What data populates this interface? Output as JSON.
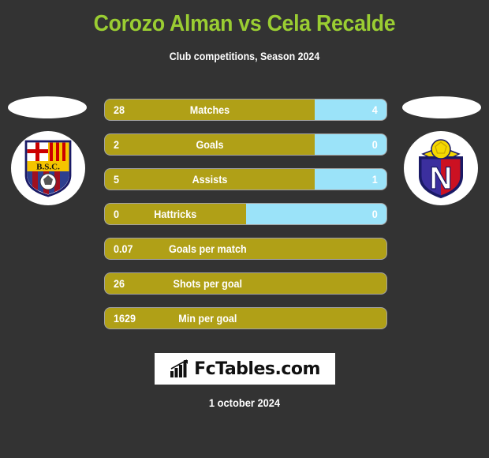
{
  "header": {
    "title": "Corozo Alman vs Cela Recalde",
    "subtitle": "Club competitions, Season 2024",
    "title_color": "#9ACD32",
    "background_color": "#333333"
  },
  "teams": {
    "home": {
      "crest_name": "barcelona-sc-crest",
      "crest_text": "B.S.C."
    },
    "away": {
      "crest_name": "el-nacional-crest",
      "crest_text": "N"
    }
  },
  "colors": {
    "home_bar": "#B0A017",
    "away_bar": "#9BE3F9",
    "text": "#ffffff"
  },
  "stats": [
    {
      "label": "Matches",
      "home": "28",
      "away": "4",
      "home_pct": 74.5,
      "two_sided": true
    },
    {
      "label": "Goals",
      "home": "2",
      "away": "0",
      "home_pct": 74.5,
      "two_sided": true
    },
    {
      "label": "Assists",
      "home": "5",
      "away": "1",
      "home_pct": 74.5,
      "two_sided": true
    },
    {
      "label": "Hattricks",
      "home": "0",
      "away": "0",
      "home_pct": 50.0,
      "two_sided": true
    },
    {
      "label": "Goals per match",
      "home": "0.07",
      "away": "",
      "home_pct": 100,
      "two_sided": false
    },
    {
      "label": "Shots per goal",
      "home": "26",
      "away": "",
      "home_pct": 100,
      "two_sided": false
    },
    {
      "label": "Min per goal",
      "home": "1629",
      "away": "",
      "home_pct": 100,
      "two_sided": false
    }
  ],
  "footer": {
    "brand": "FcTables.com",
    "brand_icon": "bar-chart-arrow-icon",
    "date": "1 october 2024"
  }
}
